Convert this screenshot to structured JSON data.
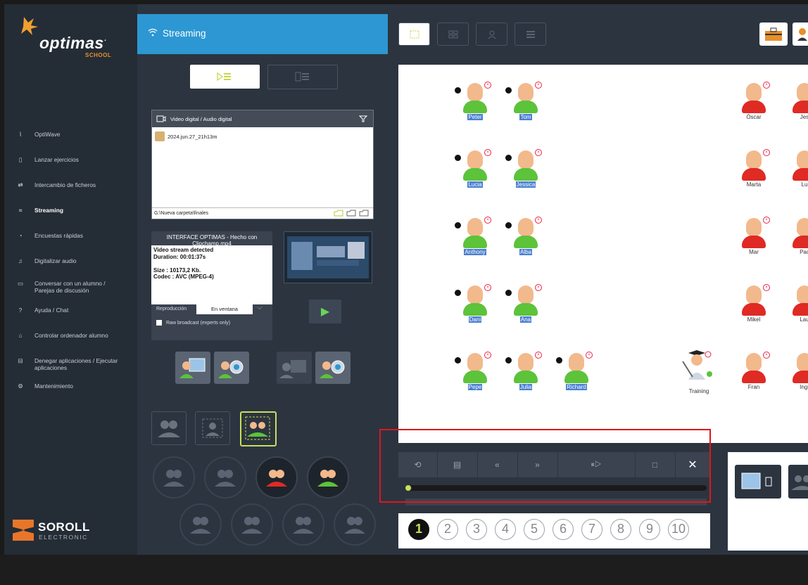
{
  "app": {
    "name": "optimas",
    "sub": "SCHOOL"
  },
  "nav": {
    "items": [
      {
        "label": "OptiWave",
        "icon": "wave-icon",
        "active": false
      },
      {
        "label": "Lanzar ejercicios",
        "icon": "exercise-icon",
        "active": false
      },
      {
        "label": "Intercambio de ficheros",
        "icon": "exchange-icon",
        "active": false
      },
      {
        "label": "Streaming",
        "icon": "wifi-icon",
        "active": true
      },
      {
        "label": "Encuestas rápidas",
        "icon": "survey-icon",
        "active": false
      },
      {
        "label": "Digitalizar audio",
        "icon": "audio-icon",
        "active": false
      },
      {
        "label": "Conversar con un alumno / Parejas de discusión",
        "icon": "chat-icon",
        "active": false
      },
      {
        "label": "Ayuda / Chat",
        "icon": "help-icon",
        "active": false
      },
      {
        "label": "Controlar ordenador alumno",
        "icon": "control-icon",
        "active": false
      },
      {
        "label": "Denegar aplicaciones / Ejecutar aplicaciones",
        "icon": "deny-icon",
        "active": false
      },
      {
        "label": "Mantenimiento",
        "icon": "maintenance-icon",
        "active": false
      }
    ]
  },
  "brand": {
    "name": "SOROLL",
    "sub": "ELECTRONIC"
  },
  "panel": {
    "title": "Streaming",
    "source_label": "Video digital / Audio digital",
    "file_name": "2024.jun.27_21h13m",
    "path": "G:\\Nueva carpeta\\finales",
    "info": {
      "title": "INTERFACE OPTIMAS - Hecho con Clipchamp.mp4",
      "lines": [
        "Video stream detected",
        "Duration: 00:01:37s",
        "",
        "Size : 10173,2 Kb.",
        "Codec : AVC (MPEG-4)"
      ]
    },
    "reproduccion_label": "Reproducción",
    "reproduccion_value": "En ventana",
    "raw_broadcast": "Raw broadcast (experts only)"
  },
  "students": [
    {
      "name": "Peter",
      "color": "green",
      "selected": true
    },
    {
      "name": "Tom",
      "color": "green",
      "selected": true
    },
    {
      "name": "Lucia",
      "color": "green",
      "selected": true
    },
    {
      "name": "Jessica",
      "color": "green",
      "selected": true
    },
    {
      "name": "Anthony",
      "color": "green",
      "selected": true
    },
    {
      "name": "Alba",
      "color": "green",
      "selected": true
    },
    {
      "name": "Dani",
      "color": "green",
      "selected": true
    },
    {
      "name": "Ana",
      "color": "green",
      "selected": true
    },
    {
      "name": "Pepe",
      "color": "green",
      "selected": true
    },
    {
      "name": "Julia",
      "color": "green",
      "selected": true
    },
    {
      "name": "Richard",
      "color": "green",
      "selected": true
    },
    {
      "name": "Óscar",
      "color": "red",
      "selected": false
    },
    {
      "name": "Jes",
      "color": "red",
      "selected": false
    },
    {
      "name": "Marta",
      "color": "red",
      "selected": false
    },
    {
      "name": "Lu",
      "color": "red",
      "selected": false
    },
    {
      "name": "Mar",
      "color": "red",
      "selected": false
    },
    {
      "name": "Pac",
      "color": "red",
      "selected": false
    },
    {
      "name": "Mikel",
      "color": "red",
      "selected": false
    },
    {
      "name": "Lau",
      "color": "red",
      "selected": false
    },
    {
      "name": "Fran",
      "color": "red",
      "selected": false
    },
    {
      "name": "Ingr",
      "color": "red",
      "selected": false
    }
  ],
  "teacher": {
    "name": "Training"
  },
  "player": {
    "progress": 0.01
  },
  "pages": [
    "1",
    "2",
    "3",
    "4",
    "5",
    "6",
    "7",
    "8",
    "9",
    "10"
  ],
  "colors": {
    "accent": "#2d97d3",
    "online": "#5cc33a",
    "offline": "#e02a24",
    "highlight": "#e0161b"
  }
}
